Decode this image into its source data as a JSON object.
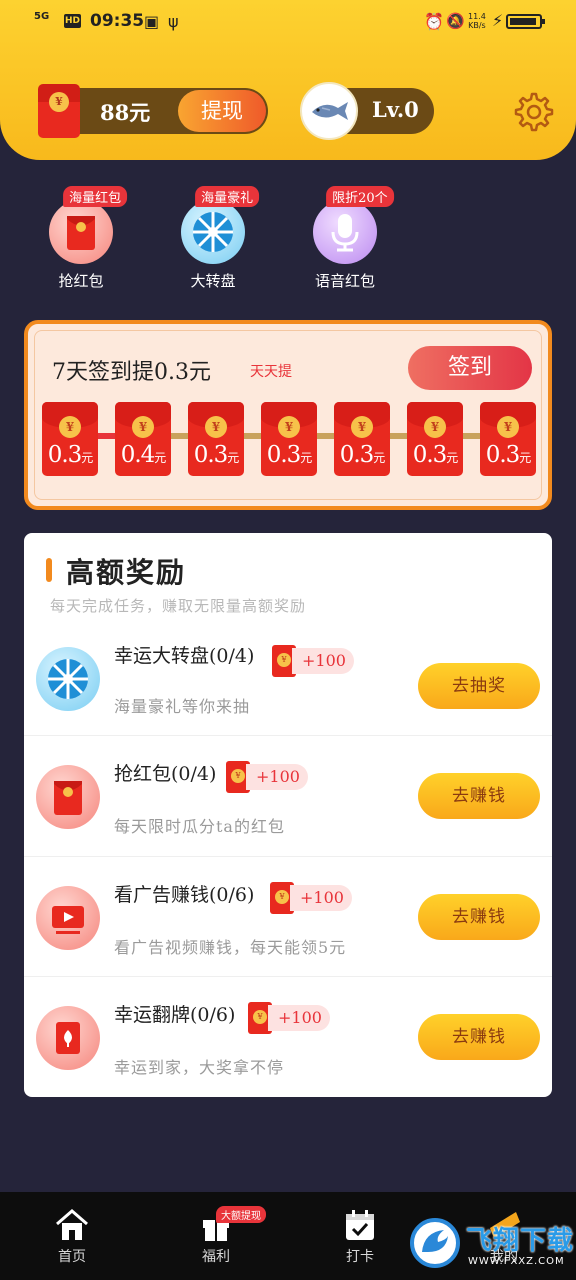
{
  "status_bar": {
    "network": "5G",
    "hd": "HD",
    "time": "09:35",
    "speed_value": "11.4",
    "speed_unit": "KB/s"
  },
  "header": {
    "balance": "88元",
    "withdraw_label": "提现",
    "level": "Lv.0"
  },
  "quick_entries": [
    {
      "label": "抢红包",
      "tag": "海量红包",
      "icon": "red-envelope-icon"
    },
    {
      "label": "大转盘",
      "tag": "海量豪礼",
      "icon": "wheel-icon"
    },
    {
      "label": "语音红包",
      "tag": "限折20个",
      "icon": "microphone-icon"
    }
  ],
  "signin": {
    "title": "7天签到提0.3元",
    "subtitle": "天天提",
    "button": "签到",
    "days": [
      {
        "amount": "0.3",
        "unit": "元"
      },
      {
        "amount": "0.4",
        "unit": "元"
      },
      {
        "amount": "0.3",
        "unit": "元"
      },
      {
        "amount": "0.3",
        "unit": "元"
      },
      {
        "amount": "0.3",
        "unit": "元"
      },
      {
        "amount": "0.3",
        "unit": "元"
      },
      {
        "amount": "0.3",
        "unit": "元"
      }
    ]
  },
  "rewards": {
    "title": "高额奖励",
    "subtitle": "每天完成任务，赚取无限量高额奖励",
    "tasks": [
      {
        "name": "幸运大转盘(0/4)",
        "points": "+100",
        "desc": "海量豪礼等你来抽",
        "button": "去抽奖",
        "icon": "wheel-icon"
      },
      {
        "name": "抢红包(0/4)",
        "points": "+100",
        "desc": "每天限时瓜分ta的红包",
        "button": "去赚钱",
        "icon": "red-envelope-icon"
      },
      {
        "name": "看广告赚钱(0/6)",
        "points": "+100",
        "desc": "看广告视频赚钱，每天能领5元",
        "button": "去赚钱",
        "icon": "video-icon"
      },
      {
        "name": "幸运翻牌(0/6)",
        "points": "+100",
        "desc": "幸运到家，大奖拿不停",
        "button": "去赚钱",
        "icon": "card-icon"
      }
    ]
  },
  "bottom_nav": {
    "items": [
      {
        "label": "首页",
        "icon": "home-icon"
      },
      {
        "label": "福利",
        "icon": "gift-icon",
        "badge": "大额提现"
      },
      {
        "label": "打卡",
        "icon": "calendar-check-icon"
      },
      {
        "label": "我的",
        "icon": "profile-icon"
      }
    ]
  },
  "watermark": {
    "text": "飞翔下载",
    "url": "WWW.FXXZ.COM"
  },
  "colors": {
    "header_yellow": "#fdd230",
    "background": "#25243a",
    "accent_orange": "#f28a1e",
    "red": "#e8291f"
  }
}
